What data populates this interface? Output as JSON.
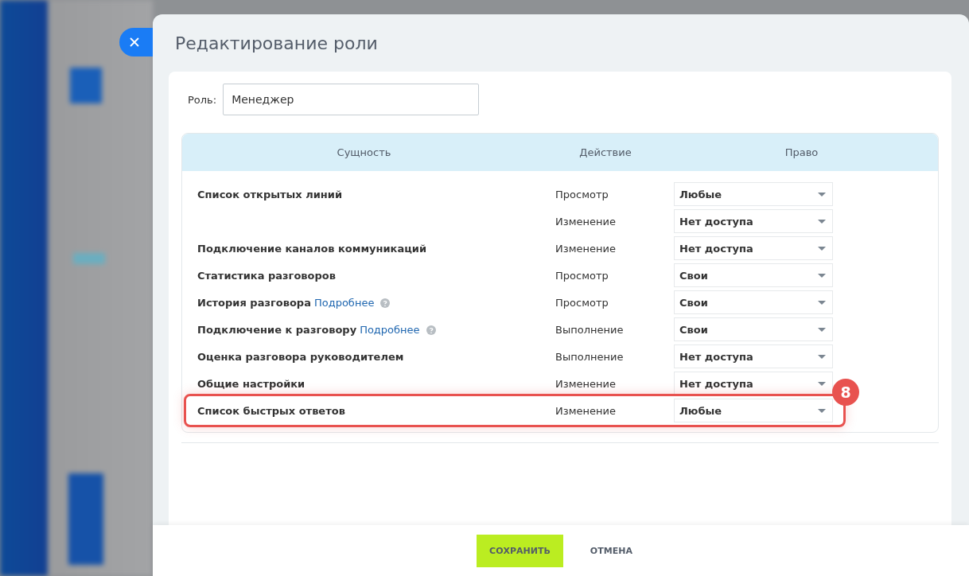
{
  "panel": {
    "title": "Редактирование роли"
  },
  "role": {
    "label": "Роль:",
    "value": "Менеджер"
  },
  "table": {
    "columns": [
      "Сущность",
      "Действие",
      "Право"
    ],
    "rows": [
      {
        "entity": "Список открытых линий",
        "actions": [
          {
            "action": "Просмотр",
            "right": "Любые"
          },
          {
            "action": "Изменение",
            "right": "Нет доступа"
          }
        ],
        "highlighted": false
      },
      {
        "entity": "Подключение каналов коммуникаций",
        "actions": [
          {
            "action": "Изменение",
            "right": "Нет доступа"
          }
        ],
        "highlighted": false
      },
      {
        "entity": "Статистика разговоров",
        "actions": [
          {
            "action": "Просмотр",
            "right": "Свои"
          }
        ],
        "highlighted": false
      },
      {
        "entity": "История разговора",
        "link": "Подробнее",
        "help": true,
        "actions": [
          {
            "action": "Просмотр",
            "right": "Свои"
          }
        ],
        "highlighted": false
      },
      {
        "entity": "Подключение к разговору",
        "link": "Подробнее",
        "help": true,
        "actions": [
          {
            "action": "Выполнение",
            "right": "Свои"
          }
        ],
        "highlighted": false
      },
      {
        "entity": "Оценка разговора руководителем",
        "actions": [
          {
            "action": "Выполнение",
            "right": "Нет доступа"
          }
        ],
        "highlighted": false
      },
      {
        "entity": "Общие настройки",
        "actions": [
          {
            "action": "Изменение",
            "right": "Нет доступа"
          }
        ],
        "highlighted": false
      },
      {
        "entity": "Список быстрых ответов",
        "actions": [
          {
            "action": "Изменение",
            "right": "Любые"
          }
        ],
        "highlighted": true
      }
    ]
  },
  "annotation": {
    "badge": "8"
  },
  "footer": {
    "buttons": [
      {
        "label": "СОХРАНИТЬ",
        "kind": "primary"
      },
      {
        "label": "ОТМЕНА",
        "kind": "link"
      }
    ]
  }
}
